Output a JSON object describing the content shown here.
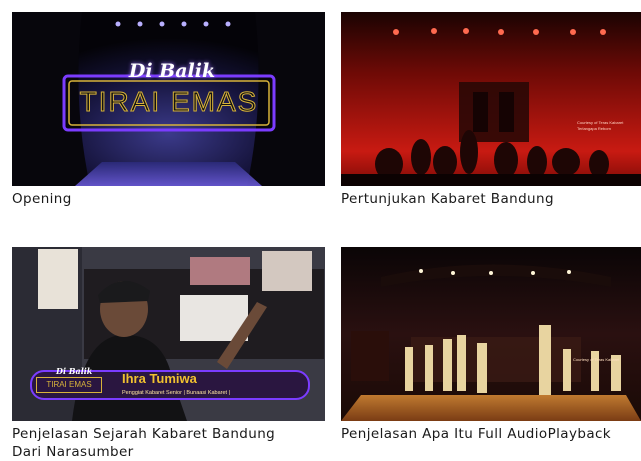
{
  "videos": [
    {
      "caption": "Opening",
      "overlay": {
        "script_title": "Di Balik",
        "main_title": "TIRAI EMAS"
      }
    },
    {
      "caption": "Pertunjukan Kabaret Bandung",
      "overlay": {
        "credit_line1": "Courtesy of Teras Kabaret",
        "credit_line2": "Terlangapa Reborn"
      }
    },
    {
      "caption_line1": "Penjelasan Sejarah Kabaret Bandung",
      "caption_line2": "Dari Narasumber",
      "overlay": {
        "logo_script": "Di Balik",
        "logo_main": "TIRAI EMAS",
        "speaker_name": "Ihra Tumiwa",
        "speaker_role": "Penggiat Kabaret Senior | Bunaasi Kabaret |"
      }
    },
    {
      "caption": "Penjelasan Apa Itu Full AudioPlayback",
      "overlay": {
        "credit_line1": "Courtesy of Teras Kabaret"
      }
    }
  ],
  "colors": {
    "neon_purple": "#7b3cff",
    "gold": "#d8b33a",
    "stage_red": "#c81a12",
    "caption_text": "#1a1a1a",
    "lower_third": "#5b2a86"
  }
}
